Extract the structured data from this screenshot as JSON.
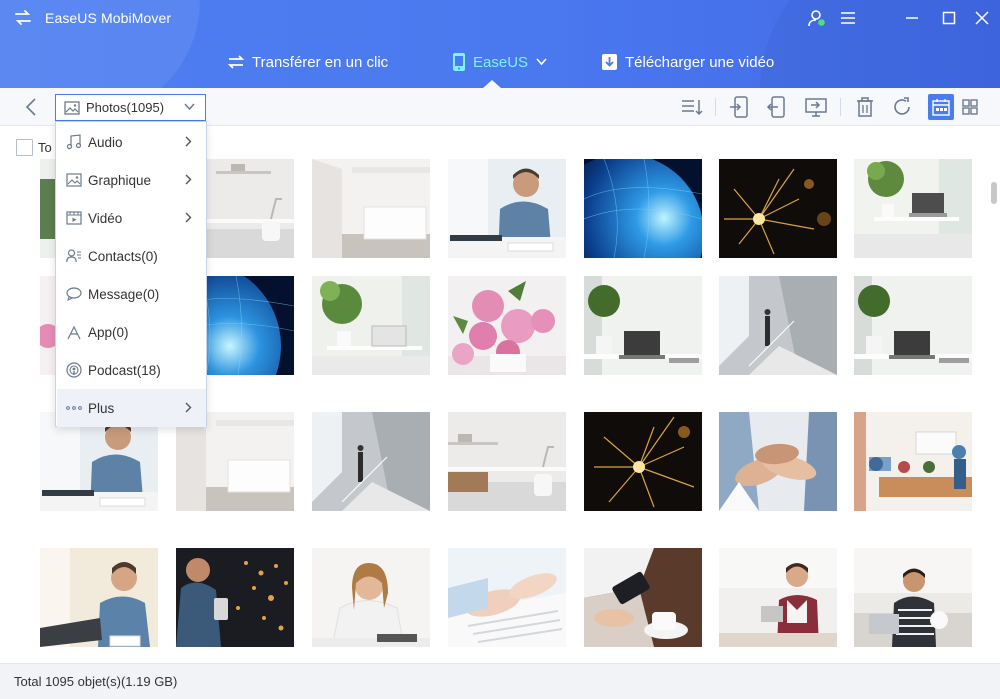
{
  "app": {
    "title": "EaseUS MobiMover",
    "logo_icon": "transfer-arrows-icon"
  },
  "window_controls": {
    "icons": [
      "account-icon",
      "menu-icon",
      "minimize-icon",
      "maximize-icon",
      "close-icon"
    ]
  },
  "nav_tabs": [
    {
      "label": "Transférer en un clic",
      "icon": "transfer-arrows-icon",
      "active": false
    },
    {
      "label": "EaseUS",
      "icon": "phone-icon",
      "active": true
    },
    {
      "label": "Télécharger une vidéo",
      "icon": "download-icon",
      "active": false
    }
  ],
  "toolbar": {
    "category": {
      "label": "Photos(1095)",
      "icon": "image-icon"
    },
    "actions": [
      "sort-icon",
      "export-to-device-icon",
      "import-icon",
      "export-to-pc-icon",
      "delete-icon",
      "refresh-icon",
      "calendar-view-icon",
      "grid-view-icon"
    ],
    "selected_view": "calendar-view-icon"
  },
  "select_all": {
    "label": "To"
  },
  "dropdown": {
    "items": [
      {
        "label": "Audio",
        "icon": "music-note-icon",
        "submenu": true
      },
      {
        "label": "Graphique",
        "icon": "image-icon",
        "submenu": true
      },
      {
        "label": "Vidéo",
        "icon": "video-icon",
        "submenu": true
      },
      {
        "label": "Contacts(0)",
        "icon": "contacts-icon",
        "submenu": false
      },
      {
        "label": "Message(0)",
        "icon": "message-icon",
        "submenu": false
      },
      {
        "label": "App(0)",
        "icon": "app-icon",
        "submenu": false
      },
      {
        "label": "Podcast(18)",
        "icon": "podcast-icon",
        "submenu": false
      },
      {
        "label": "Plus",
        "icon": "more-icon",
        "submenu": true
      }
    ],
    "hovered_item": "Plus"
  },
  "photos": [
    [
      "desk-shelf",
      "white-room",
      "man-writing-laptop",
      "earth-network",
      "sparklers",
      "office-plants"
    ],
    [
      "earth-network",
      "window-plant-laptop",
      "pink-flowers",
      "laptop-plant",
      "man-stairs",
      "laptop-plant"
    ],
    [
      "man-writing-laptop",
      "white-room",
      "man-stairs",
      "desk-shelf",
      "sparklers",
      "hands-teamwork",
      "office-meeting"
    ],
    [
      "man-laptop-smile",
      "man-phone-night",
      "woman-laptop",
      "typing-hands",
      "phone-coffee",
      "man-tablet",
      "man-couch-laptop"
    ]
  ],
  "colors": {
    "accent": "#4a7cf0",
    "active_tab": "#7df3ff",
    "header": "#4a78ef"
  },
  "status": {
    "text": "Total 1095 objet(s)(1.19 GB)"
  }
}
